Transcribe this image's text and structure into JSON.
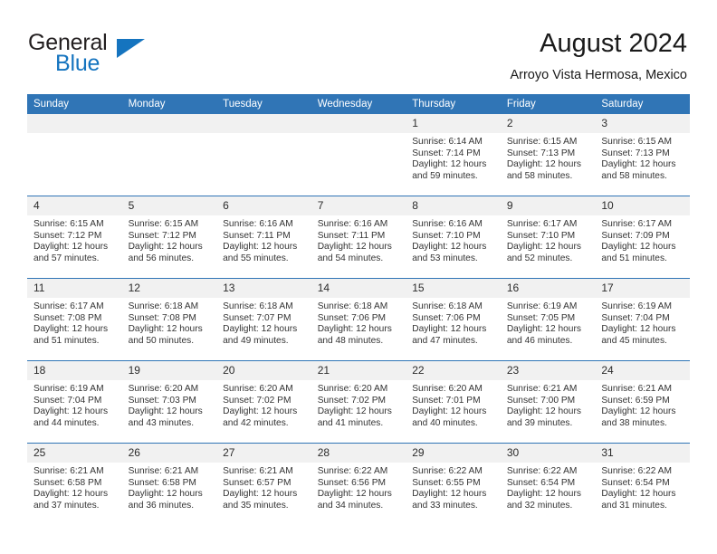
{
  "logo": {
    "word1": "General",
    "word2": "Blue",
    "triangle_color": "#1574bf",
    "icon": "triangle-icon"
  },
  "header": {
    "title": "August 2024",
    "subtitle": "Arroyo Vista Hermosa, Mexico"
  },
  "theme": {
    "header_blue": "#3075b6",
    "daynum_gray": "#f1f1f1",
    "text": "#333333"
  },
  "calendar": {
    "weekday_headers": [
      "Sunday",
      "Monday",
      "Tuesday",
      "Wednesday",
      "Thursday",
      "Friday",
      "Saturday"
    ],
    "weeks": [
      [
        {
          "day": "",
          "sunrise": "",
          "sunset": "",
          "daylight1": "",
          "daylight2": ""
        },
        {
          "day": "",
          "sunrise": "",
          "sunset": "",
          "daylight1": "",
          "daylight2": ""
        },
        {
          "day": "",
          "sunrise": "",
          "sunset": "",
          "daylight1": "",
          "daylight2": ""
        },
        {
          "day": "",
          "sunrise": "",
          "sunset": "",
          "daylight1": "",
          "daylight2": ""
        },
        {
          "day": "1",
          "sunrise": "Sunrise: 6:14 AM",
          "sunset": "Sunset: 7:14 PM",
          "daylight1": "Daylight: 12 hours",
          "daylight2": "and 59 minutes."
        },
        {
          "day": "2",
          "sunrise": "Sunrise: 6:15 AM",
          "sunset": "Sunset: 7:13 PM",
          "daylight1": "Daylight: 12 hours",
          "daylight2": "and 58 minutes."
        },
        {
          "day": "3",
          "sunrise": "Sunrise: 6:15 AM",
          "sunset": "Sunset: 7:13 PM",
          "daylight1": "Daylight: 12 hours",
          "daylight2": "and 58 minutes."
        }
      ],
      [
        {
          "day": "4",
          "sunrise": "Sunrise: 6:15 AM",
          "sunset": "Sunset: 7:12 PM",
          "daylight1": "Daylight: 12 hours",
          "daylight2": "and 57 minutes."
        },
        {
          "day": "5",
          "sunrise": "Sunrise: 6:15 AM",
          "sunset": "Sunset: 7:12 PM",
          "daylight1": "Daylight: 12 hours",
          "daylight2": "and 56 minutes."
        },
        {
          "day": "6",
          "sunrise": "Sunrise: 6:16 AM",
          "sunset": "Sunset: 7:11 PM",
          "daylight1": "Daylight: 12 hours",
          "daylight2": "and 55 minutes."
        },
        {
          "day": "7",
          "sunrise": "Sunrise: 6:16 AM",
          "sunset": "Sunset: 7:11 PM",
          "daylight1": "Daylight: 12 hours",
          "daylight2": "and 54 minutes."
        },
        {
          "day": "8",
          "sunrise": "Sunrise: 6:16 AM",
          "sunset": "Sunset: 7:10 PM",
          "daylight1": "Daylight: 12 hours",
          "daylight2": "and 53 minutes."
        },
        {
          "day": "9",
          "sunrise": "Sunrise: 6:17 AM",
          "sunset": "Sunset: 7:10 PM",
          "daylight1": "Daylight: 12 hours",
          "daylight2": "and 52 minutes."
        },
        {
          "day": "10",
          "sunrise": "Sunrise: 6:17 AM",
          "sunset": "Sunset: 7:09 PM",
          "daylight1": "Daylight: 12 hours",
          "daylight2": "and 51 minutes."
        }
      ],
      [
        {
          "day": "11",
          "sunrise": "Sunrise: 6:17 AM",
          "sunset": "Sunset: 7:08 PM",
          "daylight1": "Daylight: 12 hours",
          "daylight2": "and 51 minutes."
        },
        {
          "day": "12",
          "sunrise": "Sunrise: 6:18 AM",
          "sunset": "Sunset: 7:08 PM",
          "daylight1": "Daylight: 12 hours",
          "daylight2": "and 50 minutes."
        },
        {
          "day": "13",
          "sunrise": "Sunrise: 6:18 AM",
          "sunset": "Sunset: 7:07 PM",
          "daylight1": "Daylight: 12 hours",
          "daylight2": "and 49 minutes."
        },
        {
          "day": "14",
          "sunrise": "Sunrise: 6:18 AM",
          "sunset": "Sunset: 7:06 PM",
          "daylight1": "Daylight: 12 hours",
          "daylight2": "and 48 minutes."
        },
        {
          "day": "15",
          "sunrise": "Sunrise: 6:18 AM",
          "sunset": "Sunset: 7:06 PM",
          "daylight1": "Daylight: 12 hours",
          "daylight2": "and 47 minutes."
        },
        {
          "day": "16",
          "sunrise": "Sunrise: 6:19 AM",
          "sunset": "Sunset: 7:05 PM",
          "daylight1": "Daylight: 12 hours",
          "daylight2": "and 46 minutes."
        },
        {
          "day": "17",
          "sunrise": "Sunrise: 6:19 AM",
          "sunset": "Sunset: 7:04 PM",
          "daylight1": "Daylight: 12 hours",
          "daylight2": "and 45 minutes."
        }
      ],
      [
        {
          "day": "18",
          "sunrise": "Sunrise: 6:19 AM",
          "sunset": "Sunset: 7:04 PM",
          "daylight1": "Daylight: 12 hours",
          "daylight2": "and 44 minutes."
        },
        {
          "day": "19",
          "sunrise": "Sunrise: 6:20 AM",
          "sunset": "Sunset: 7:03 PM",
          "daylight1": "Daylight: 12 hours",
          "daylight2": "and 43 minutes."
        },
        {
          "day": "20",
          "sunrise": "Sunrise: 6:20 AM",
          "sunset": "Sunset: 7:02 PM",
          "daylight1": "Daylight: 12 hours",
          "daylight2": "and 42 minutes."
        },
        {
          "day": "21",
          "sunrise": "Sunrise: 6:20 AM",
          "sunset": "Sunset: 7:02 PM",
          "daylight1": "Daylight: 12 hours",
          "daylight2": "and 41 minutes."
        },
        {
          "day": "22",
          "sunrise": "Sunrise: 6:20 AM",
          "sunset": "Sunset: 7:01 PM",
          "daylight1": "Daylight: 12 hours",
          "daylight2": "and 40 minutes."
        },
        {
          "day": "23",
          "sunrise": "Sunrise: 6:21 AM",
          "sunset": "Sunset: 7:00 PM",
          "daylight1": "Daylight: 12 hours",
          "daylight2": "and 39 minutes."
        },
        {
          "day": "24",
          "sunrise": "Sunrise: 6:21 AM",
          "sunset": "Sunset: 6:59 PM",
          "daylight1": "Daylight: 12 hours",
          "daylight2": "and 38 minutes."
        }
      ],
      [
        {
          "day": "25",
          "sunrise": "Sunrise: 6:21 AM",
          "sunset": "Sunset: 6:58 PM",
          "daylight1": "Daylight: 12 hours",
          "daylight2": "and 37 minutes."
        },
        {
          "day": "26",
          "sunrise": "Sunrise: 6:21 AM",
          "sunset": "Sunset: 6:58 PM",
          "daylight1": "Daylight: 12 hours",
          "daylight2": "and 36 minutes."
        },
        {
          "day": "27",
          "sunrise": "Sunrise: 6:21 AM",
          "sunset": "Sunset: 6:57 PM",
          "daylight1": "Daylight: 12 hours",
          "daylight2": "and 35 minutes."
        },
        {
          "day": "28",
          "sunrise": "Sunrise: 6:22 AM",
          "sunset": "Sunset: 6:56 PM",
          "daylight1": "Daylight: 12 hours",
          "daylight2": "and 34 minutes."
        },
        {
          "day": "29",
          "sunrise": "Sunrise: 6:22 AM",
          "sunset": "Sunset: 6:55 PM",
          "daylight1": "Daylight: 12 hours",
          "daylight2": "and 33 minutes."
        },
        {
          "day": "30",
          "sunrise": "Sunrise: 6:22 AM",
          "sunset": "Sunset: 6:54 PM",
          "daylight1": "Daylight: 12 hours",
          "daylight2": "and 32 minutes."
        },
        {
          "day": "31",
          "sunrise": "Sunrise: 6:22 AM",
          "sunset": "Sunset: 6:54 PM",
          "daylight1": "Daylight: 12 hours",
          "daylight2": "and 31 minutes."
        }
      ]
    ]
  }
}
